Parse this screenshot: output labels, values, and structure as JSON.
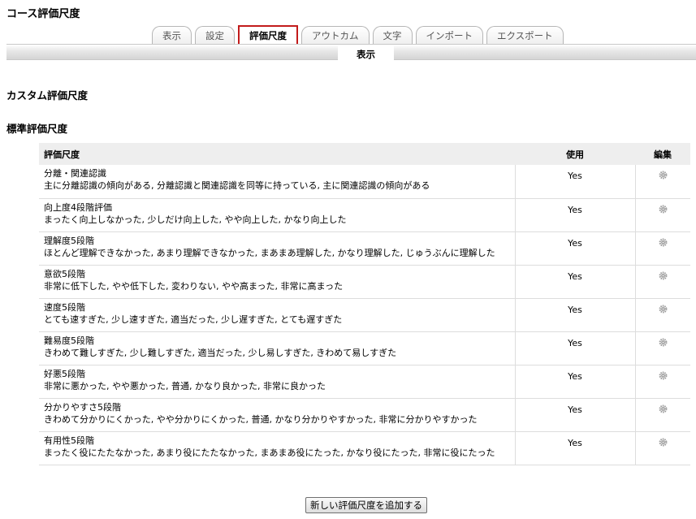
{
  "page": {
    "title": "コース評価尺度"
  },
  "tabs": [
    {
      "label": "表示",
      "active": false
    },
    {
      "label": "設定",
      "active": false
    },
    {
      "label": "評価尺度",
      "active": true
    },
    {
      "label": "アウトカム",
      "active": false
    },
    {
      "label": "文字",
      "active": false
    },
    {
      "label": "インポート",
      "active": false
    },
    {
      "label": "エクスポート",
      "active": false
    }
  ],
  "subtab": {
    "label": "表示"
  },
  "sections": {
    "custom": "カスタム評価尺度",
    "standard": "標準評価尺度"
  },
  "table": {
    "headers": {
      "scale": "評価尺度",
      "used": "使用",
      "edit": "編集"
    },
    "rows": [
      {
        "name": "分離・関連認識",
        "items": "主に分離認識の傾向がある, 分離認識と関連認識を同等に持っている, 主に関連認識の傾向がある",
        "used": "Yes"
      },
      {
        "name": "向上度4段階評価",
        "items": "まったく向上しなかった, 少しだけ向上した, やや向上した, かなり向上した",
        "used": "Yes"
      },
      {
        "name": "理解度5段階",
        "items": "ほとんど理解できなかった, あまり理解できなかった, まあまあ理解した, かなり理解した, じゅうぶんに理解した",
        "used": "Yes"
      },
      {
        "name": "意欲5段階",
        "items": "非常に低下した, やや低下した, 変わりない, やや高まった, 非常に高まった",
        "used": "Yes"
      },
      {
        "name": "速度5段階",
        "items": "とても速すぎた, 少し速すぎた, 適当だった, 少し遅すぎた, とても遅すぎた",
        "used": "Yes"
      },
      {
        "name": "難易度5段階",
        "items": "きわめて難しすぎた, 少し難しすぎた, 適当だった, 少し易しすぎた, きわめて易しすぎた",
        "used": "Yes"
      },
      {
        "name": "好悪5段階",
        "items": "非常に悪かった, やや悪かった, 普通, かなり良かった, 非常に良かった",
        "used": "Yes"
      },
      {
        "name": "分かりやすさ5段階",
        "items": "きわめて分かりにくかった, やや分かりにくかった, 普通, かなり分かりやすかった, 非常に分かりやすかった",
        "used": "Yes"
      },
      {
        "name": "有用性5段階",
        "items": "まったく役にたたなかった, あまり役にたたなかった, まあまあ役にたった, かなり役にたった, 非常に役にたった",
        "used": "Yes"
      }
    ],
    "edit_icon": "gear-icon"
  },
  "buttons": {
    "add_scale": "新しい評価尺度を追加する"
  },
  "colors": {
    "active_tab_border": "#c21b1b",
    "header_bg": "#eeeeee",
    "gear": "#9a9a9a"
  }
}
